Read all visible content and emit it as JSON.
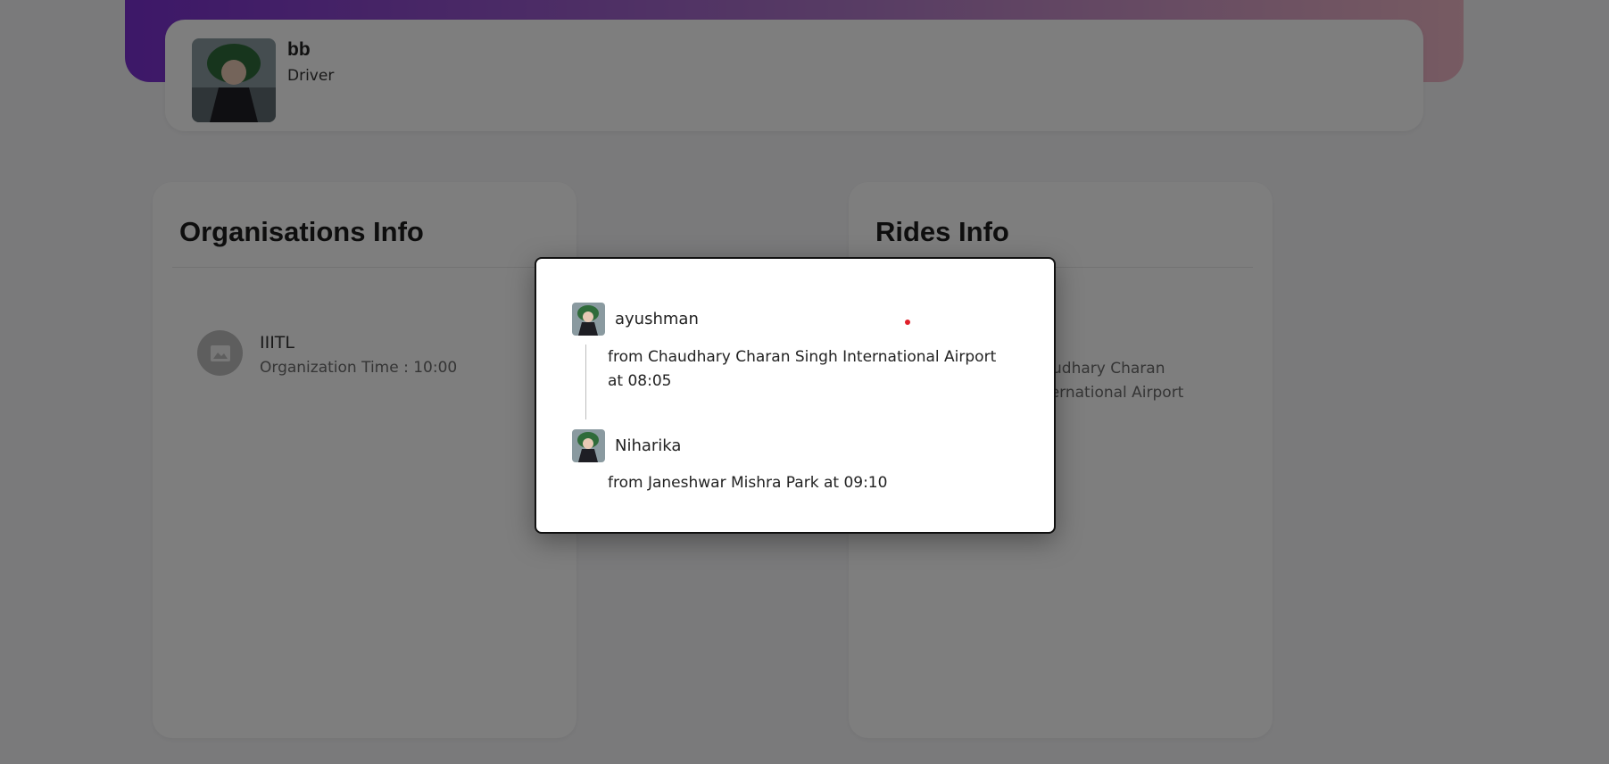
{
  "profile": {
    "name": "bb",
    "role": "Driver",
    "avatar_icon": "user-avatar-image"
  },
  "organisations": {
    "title": "Organisations Info",
    "items": [
      {
        "name": "IIITL",
        "time": "Organization Time : 10:00",
        "icon": "image-placeholder-icon"
      }
    ]
  },
  "rides": {
    "title": "Rides Info",
    "background_text": "from Chaudhary Charan Singh International Airport at 08:05"
  },
  "modal": {
    "entries": [
      {
        "name": "ayushman",
        "text": "from Chaudhary Charan Singh International Airport at 08:05"
      },
      {
        "name": "Niharika",
        "text": "from Janeshwar Mishra Park at 09:10"
      }
    ]
  },
  "colors": {
    "gradient_start": "#7a2fd0",
    "gradient_end": "#eeb6c4",
    "status_dot": "#e0202a"
  }
}
